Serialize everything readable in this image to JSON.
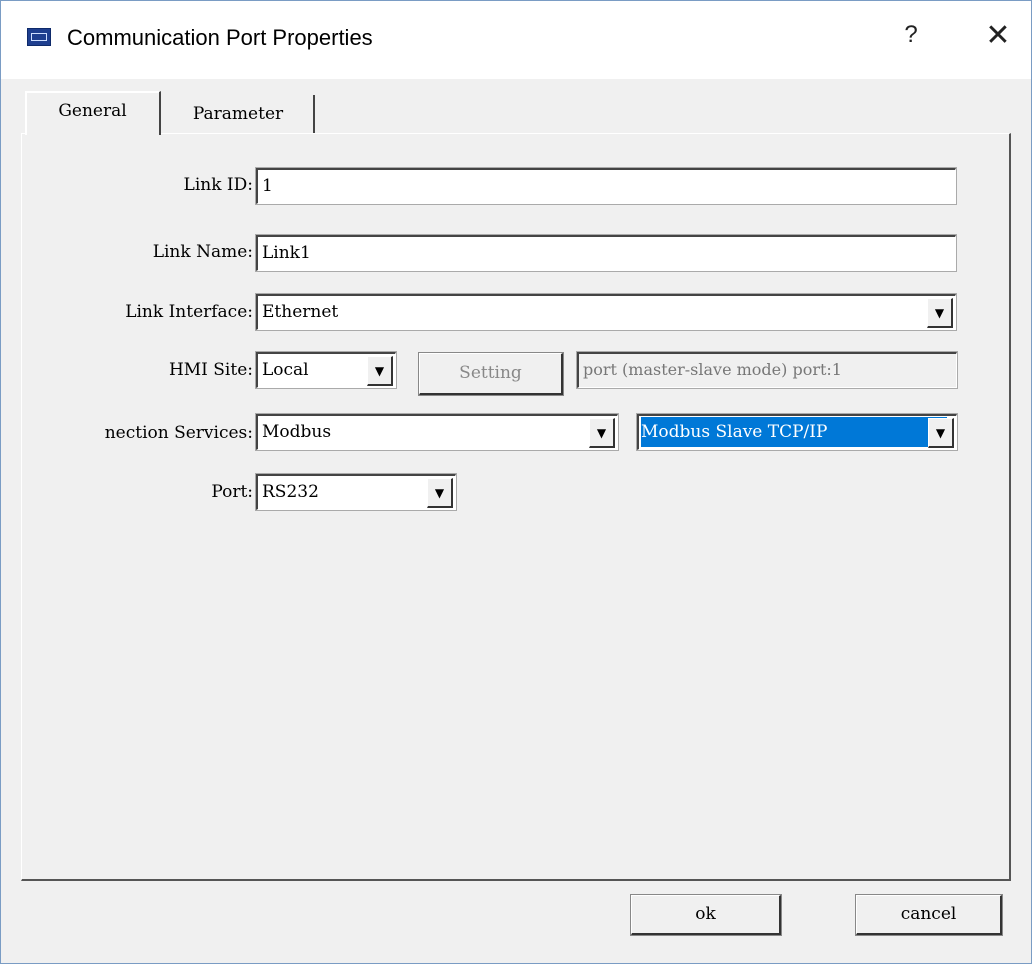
{
  "window": {
    "title": "Communication Port Properties",
    "help_label": "?",
    "close_label": "✕"
  },
  "tabs": [
    {
      "label": "General",
      "active": true
    },
    {
      "label": "Parameter",
      "active": false
    }
  ],
  "form": {
    "link_id": {
      "label": "Link ID:",
      "value": "1"
    },
    "link_name": {
      "label": "Link Name:",
      "value": "Link1"
    },
    "link_interface": {
      "label": "Link Interface:",
      "value": "Ethernet"
    },
    "hmi_site": {
      "label": "HMI Site:",
      "value": "Local"
    },
    "setting_button": "Setting",
    "port_info": "port (master-slave mode) port:1",
    "connection_services": {
      "label": "nection Services:",
      "value": "Modbus",
      "sub_value": "Modbus Slave TCP/IP"
    },
    "port": {
      "label": "Port:",
      "value": "RS232"
    }
  },
  "footer": {
    "ok_label": "ok",
    "cancel_label": "cancel"
  },
  "dropdown_glyph": "▼"
}
